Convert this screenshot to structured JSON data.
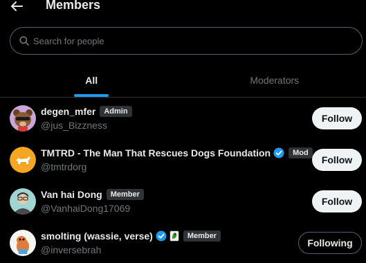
{
  "header": {
    "title": "Members",
    "back_icon": "arrow-left-icon"
  },
  "search": {
    "placeholder": "Search for people",
    "value": "",
    "icon": "search-icon"
  },
  "tabs": [
    {
      "label": "All",
      "active": true
    },
    {
      "label": "Moderators",
      "active": false
    }
  ],
  "members": [
    {
      "name": "degen_mfer",
      "handle": "@jus_Bizzness",
      "badge": "Admin",
      "verified": false,
      "button": "Follow"
    },
    {
      "name": "TMTRD - The Man That Rescues Dogs Foundation",
      "handle": "@tmtrdorg",
      "badge": "Mod",
      "verified": true,
      "button": "Follow"
    },
    {
      "name": "Van hai Dong",
      "handle": "@VanhaiDong17069",
      "badge": "Member",
      "verified": false,
      "button": "Follow"
    },
    {
      "name": "smolting (wassie, verse)",
      "handle": "@inversebrah",
      "badge": "Member",
      "verified": true,
      "affiliate_icon": "affiliate-badge-icon",
      "button": "Following"
    }
  ],
  "colors": {
    "accent": "#1d9bf0",
    "background": "#000000",
    "muted": "#71767b",
    "badge_bg": "#2f3336"
  }
}
